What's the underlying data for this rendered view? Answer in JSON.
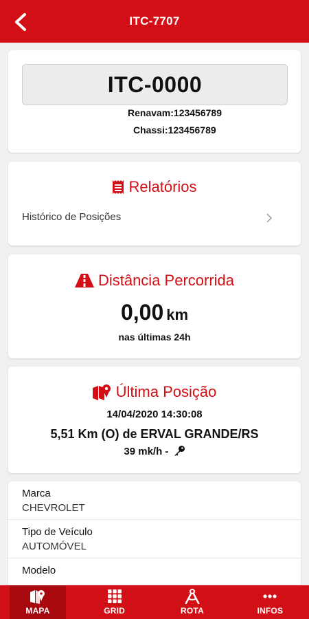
{
  "header": {
    "title": "ITC-7707"
  },
  "vehicle": {
    "plate": "ITC-0000",
    "renavam": "Renavam:123456789",
    "chassi": "Chassi:123456789"
  },
  "reports": {
    "title": "Relatórios",
    "items": [
      {
        "label": "Histórico de Posições"
      }
    ]
  },
  "distance": {
    "title": "Distância Percorrida",
    "value": "0,00",
    "unit": "km",
    "period": "nas últimas 24h"
  },
  "last_position": {
    "title": "Última Posição",
    "datetime": "14/04/2020 14:30:08",
    "location": "5,51 Km (O) de ERVAL GRANDE/RS",
    "speed": "39 mk/h -"
  },
  "info": {
    "items": [
      {
        "label": "Marca",
        "value": "CHEVROLET"
      },
      {
        "label": "Tipo de Veículo",
        "value": "AUTOMÓVEL"
      },
      {
        "label": "Modelo",
        "value": ""
      }
    ]
  },
  "nav": {
    "items": [
      {
        "label": "MAPA",
        "icon": "map-icon"
      },
      {
        "label": "GRID",
        "icon": "grid-icon"
      },
      {
        "label": "ROTA",
        "icon": "route-icon"
      },
      {
        "label": "INFOS",
        "icon": "more-icon"
      }
    ],
    "active": "MAPA"
  },
  "colors": {
    "brand": "#d20f16",
    "background": "#f0f0f0"
  }
}
